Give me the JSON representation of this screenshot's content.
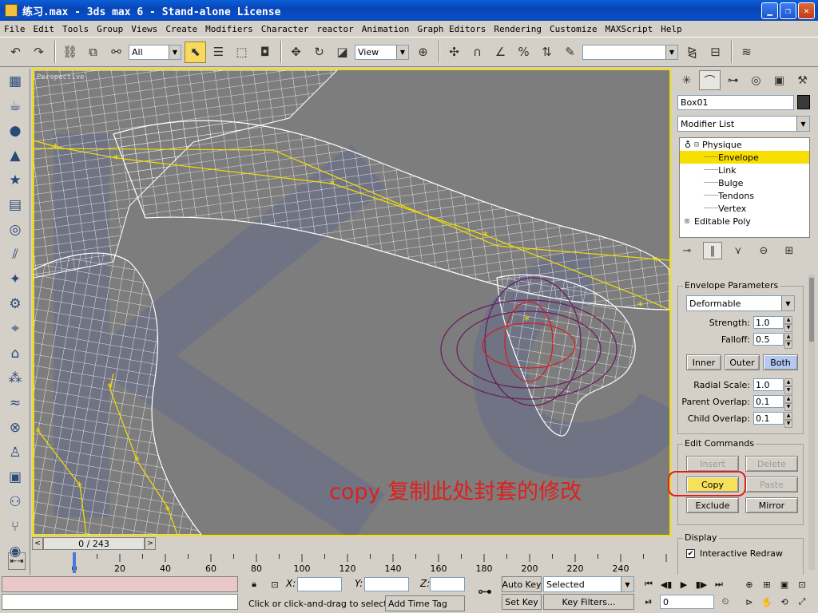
{
  "window": {
    "title": "练习.max - 3ds max 6 - Stand-alone License"
  },
  "menu": [
    "File",
    "Edit",
    "Tools",
    "Group",
    "Views",
    "Create",
    "Modifiers",
    "Character",
    "reactor",
    "Animation",
    "Graph Editors",
    "Rendering",
    "Customize",
    "MAXScript",
    "Help"
  ],
  "toolbar": {
    "selection_filter": "All",
    "ref_coord": "View",
    "named_selection": ""
  },
  "viewport": {
    "label": "Perspective",
    "annotation": "copy 复制此处封套的修改"
  },
  "command_panel": {
    "object_name": "Box01",
    "modifier_list": "Modifier List",
    "stack": [
      {
        "label": "Physique",
        "level": 0,
        "expander": "⊟",
        "selected": false
      },
      {
        "label": "Envelope",
        "level": 1,
        "selected": true
      },
      {
        "label": "Link",
        "level": 1,
        "selected": false
      },
      {
        "label": "Bulge",
        "level": 1,
        "selected": false
      },
      {
        "label": "Tendons",
        "level": 1,
        "selected": false
      },
      {
        "label": "Vertex",
        "level": 1,
        "selected": false
      },
      {
        "label": "Editable Poly",
        "level": 0,
        "expander": "⊞",
        "selected": false
      }
    ],
    "envelope_params": {
      "title": "Envelope Parameters",
      "type": "Deformable",
      "strength_label": "Strength:",
      "strength": "1.0",
      "falloff_label": "Falloff:",
      "falloff": "0.5",
      "inner": "Inner",
      "outer": "Outer",
      "both": "Both",
      "radial_scale_label": "Radial Scale:",
      "radial_scale": "1.0",
      "parent_overlap_label": "Parent Overlap:",
      "parent_overlap": "0.1",
      "child_overlap_label": "Child Overlap:",
      "child_overlap": "0.1"
    },
    "edit_commands": {
      "title": "Edit Commands",
      "insert": "Insert",
      "delete": "Delete",
      "copy": "Copy",
      "paste": "Paste",
      "exclude": "Exclude",
      "mirror": "Mirror"
    },
    "display": {
      "title": "Display",
      "interactive_redraw": "Interactive Redraw",
      "interactive_redraw_checked": true
    }
  },
  "timeline": {
    "frame_display": "0 / 243",
    "ticks": [
      "0",
      "20",
      "40",
      "60",
      "80",
      "100",
      "120",
      "140",
      "160",
      "180",
      "200",
      "220",
      "240"
    ]
  },
  "status": {
    "prompt": "Click or click-and-drag to select obj",
    "add_time_tag": "Add Time Tag",
    "x_label": "X:",
    "y_label": "Y:",
    "z_label": "Z:",
    "auto_key": "Auto Key",
    "set_key": "Set Key",
    "key_mode": "Selected",
    "key_filters": "Key Filters...",
    "current_frame": "0"
  }
}
